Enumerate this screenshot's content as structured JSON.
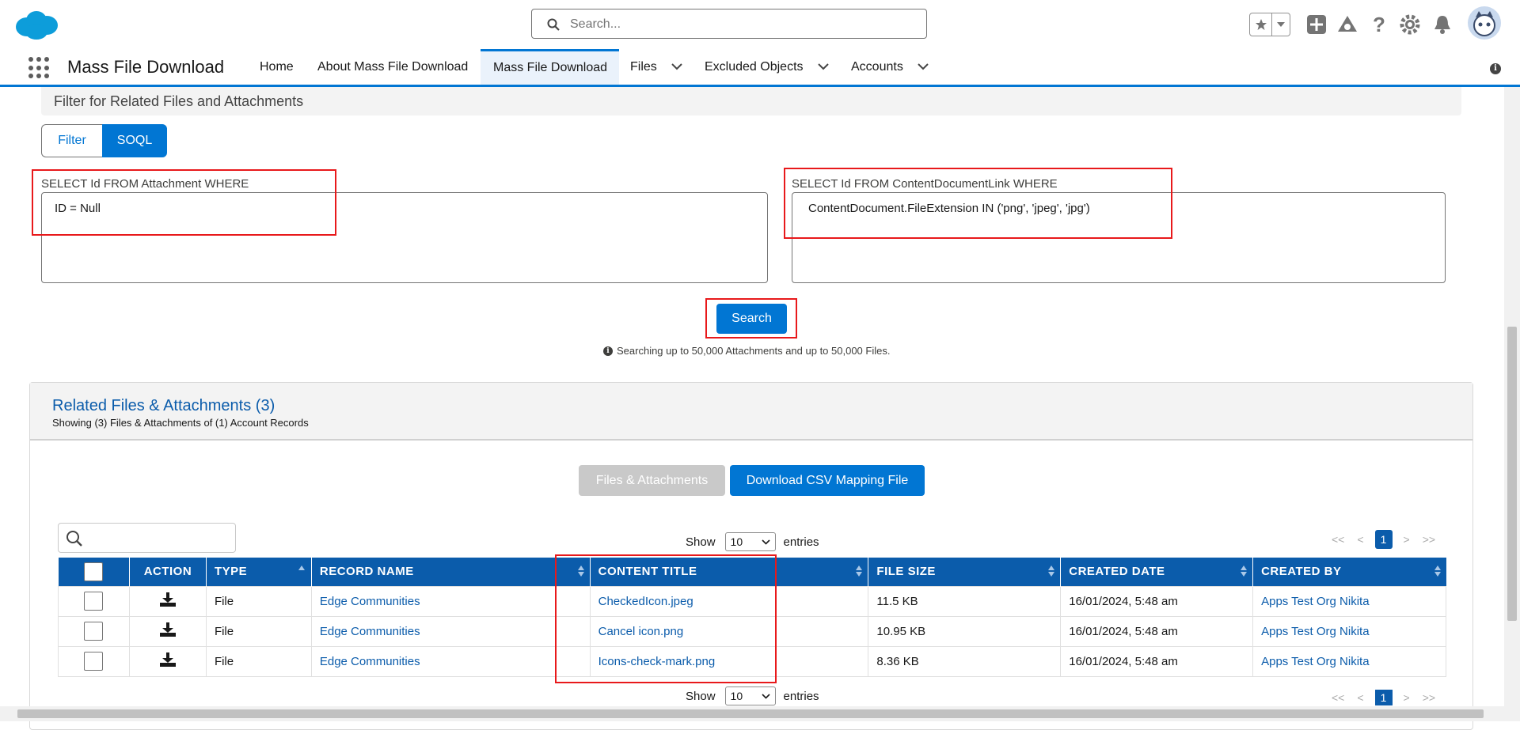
{
  "header": {
    "search_placeholder": "Search..."
  },
  "nav": {
    "app_name": "Mass File Download",
    "tabs": [
      {
        "label": "Home"
      },
      {
        "label": "About Mass File Download"
      },
      {
        "label": "Mass File Download"
      },
      {
        "label": "Files"
      },
      {
        "label": "Excluded Objects"
      },
      {
        "label": "Accounts"
      }
    ]
  },
  "filter": {
    "title": "Filter for Related Files and Attachments",
    "toggle": {
      "filter_label": "Filter",
      "soql_label": "SOQL",
      "active": "SOQL"
    },
    "attachment_label": "SELECT Id FROM Attachment WHERE",
    "attachment_query": "ID = Null",
    "content_label": "SELECT Id FROM ContentDocumentLink WHERE",
    "content_query": "ContentDocument.FileExtension IN ('png', 'jpeg', 'jpg')",
    "search_label": "Search",
    "note": "Searching up to 50,000 Attachments and up to 50,000 Files."
  },
  "related": {
    "title": "Related Files & Attachments (3)",
    "subtitle": "Showing (3) Files & Attachments of (1) Account Records",
    "files_tab_label": "Files & Attachments",
    "download_csv_label": "Download CSV Mapping File",
    "show_label": "Show",
    "entries_label": "entries",
    "page_size": "10",
    "pager": {
      "first": "<<",
      "prev": "<",
      "current": "1",
      "next": ">",
      "last": ">>"
    },
    "columns": [
      "ACTION",
      "TYPE",
      "RECORD NAME",
      "CONTENT TITLE",
      "FILE SIZE",
      "CREATED DATE",
      "CREATED BY"
    ],
    "rows": [
      {
        "type": "File",
        "record_name": "Edge Communities",
        "content_title": "CheckedIcon.jpeg",
        "file_size": "11.5 KB",
        "created_date": "16/01/2024, 5:48 am",
        "created_by": "Apps Test Org Nikita"
      },
      {
        "type": "File",
        "record_name": "Edge Communities",
        "content_title": "Cancel icon.png",
        "file_size": "10.95 KB",
        "created_date": "16/01/2024, 5:48 am",
        "created_by": "Apps Test Org Nikita"
      },
      {
        "type": "File",
        "record_name": "Edge Communities",
        "content_title": "Icons-check-mark.png",
        "file_size": "8.36 KB",
        "created_date": "16/01/2024, 5:48 am",
        "created_by": "Apps Test Org Nikita"
      }
    ]
  },
  "colors": {
    "brand": "#0176d3",
    "header_blue": "#0b5cab",
    "highlight_red": "#e8191b"
  },
  "icons": [
    "salesforce-cloud-icon",
    "search-icon",
    "star-icon",
    "plus-icon",
    "trailhead-icon",
    "help-icon",
    "gear-icon",
    "bell-icon",
    "app-launcher-icon",
    "chevron-down-icon",
    "info-icon",
    "download-icon"
  ]
}
